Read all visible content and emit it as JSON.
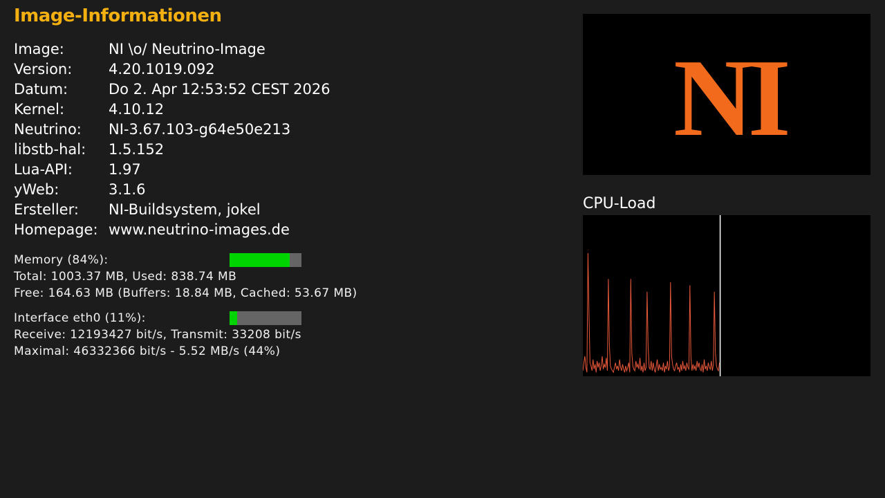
{
  "page": {
    "title": "Image-Informationen"
  },
  "info_rows": [
    {
      "label": "Image:",
      "value": "NI \\o/ Neutrino-Image"
    },
    {
      "label": "Version:",
      "value": "4.20.1019.092"
    },
    {
      "label": "Datum:",
      "value": "Do 2. Apr 12:53:52 CEST 2026"
    },
    {
      "label": "Kernel:",
      "value": "4.10.12"
    },
    {
      "label": "Neutrino:",
      "value": "NI-3.67.103-g64e50e213"
    },
    {
      "label": "libstb-hal:",
      "value": "1.5.152"
    },
    {
      "label": "Lua-API:",
      "value": "1.97"
    },
    {
      "label": "yWeb:",
      "value": "3.1.6"
    },
    {
      "label": "Ersteller:",
      "value": "NI-Buildsystem, jokel"
    },
    {
      "label": "Homepage:",
      "value": "www.neutrino-images.de"
    }
  ],
  "memory": {
    "label": "Memory (84%):",
    "percent": 84,
    "total_line": "Total: 1003.37 MB, Used: 838.74 MB",
    "free_line": "Free: 164.63 MB (Buffers: 18.84 MB, Cached: 53.67 MB)"
  },
  "network": {
    "label": "Interface eth0 (11%):",
    "percent": 11,
    "receive_line": "Receive: 12193427 bit/s, Transmit: 33208 bit/s",
    "max_line": "Maximal: 46332366 bit/s - 5.52 MB/s (44%)"
  },
  "logo": {
    "text": "NI",
    "color": "#f26a1b"
  },
  "cpu": {
    "title": "CPU-Load",
    "line_color": "#e8583a",
    "marker_color": "#ffffff",
    "history_fraction": 0.475,
    "values": [
      3,
      8,
      12,
      5,
      2,
      76,
      40,
      8,
      6,
      3,
      10,
      4,
      7,
      2,
      9,
      5,
      8,
      3,
      6,
      12,
      4,
      7,
      5,
      11,
      3,
      60,
      20,
      6,
      4,
      3,
      2,
      5,
      8,
      4,
      6,
      3,
      10,
      5,
      3,
      7,
      4,
      2,
      6,
      3,
      5,
      8,
      2,
      60,
      14,
      6,
      4,
      3,
      9,
      5,
      7,
      4,
      11,
      3,
      6,
      2,
      8,
      3,
      5,
      52,
      18,
      5,
      4,
      9,
      3,
      8,
      4,
      2,
      6,
      10,
      3,
      7,
      4,
      5,
      3,
      8,
      2,
      6,
      4,
      9,
      3,
      5,
      58,
      12,
      7,
      4,
      3,
      6,
      8,
      4,
      5,
      2,
      7,
      3,
      9,
      4,
      6,
      3,
      8,
      5,
      4,
      56,
      12,
      3,
      7,
      4,
      6,
      3,
      9,
      5,
      8,
      4,
      3,
      7,
      2,
      10,
      4,
      6,
      3,
      8,
      5,
      4,
      9,
      3,
      7,
      52,
      14,
      6,
      4,
      3,
      8
    ]
  }
}
